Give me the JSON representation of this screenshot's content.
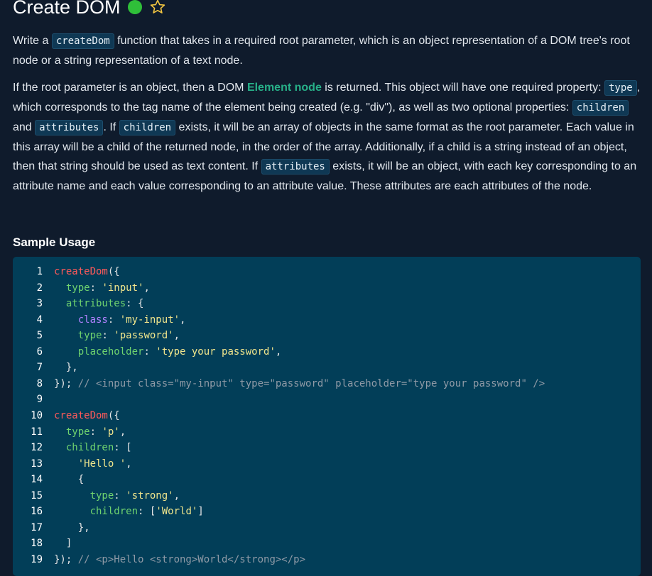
{
  "header": {
    "title": "Create DOM",
    "status_color": "#2fbf39",
    "star_icon": "star-outline-icon"
  },
  "description": {
    "p1": {
      "before": "Write a ",
      "code": "createDom",
      "after": " function that takes in a required root parameter, which is an object representation of a DOM tree's root node or a string representation of a text node."
    },
    "p2": {
      "t1": "If the root parameter is an object, then a DOM ",
      "link": "Element node",
      "t2": " is returned. This object will have one required property: ",
      "c1": "type",
      "t3": ", which corresponds to the tag name of the element being created (e.g. \"div\"), as well as two optional properties: ",
      "c2": "children",
      "t4": " and ",
      "c3": "attributes",
      "t5": ". If ",
      "c4": "children",
      "t6": " exists, it will be an array of objects in the same format as the root parameter. Each value in this array will be a child of the returned node, in the order of the array. Additionally, if a child is a string instead of an object, then that string should be used as text content. If ",
      "c5": "attributes",
      "t7": " exists, it will be an object, with each key corresponding to an attribute name and each value corresponding to an attribute value. These attributes are each attributes of the node."
    }
  },
  "sample": {
    "title": "Sample Usage",
    "lines": [
      {
        "n": "1",
        "tokens": [
          [
            "fn",
            "createDom"
          ],
          [
            "punc",
            "({"
          ]
        ]
      },
      {
        "n": "2",
        "tokens": [
          [
            "punc",
            "  "
          ],
          [
            "key",
            "type"
          ],
          [
            "punc",
            ": "
          ],
          [
            "str",
            "'input'"
          ],
          [
            "punc",
            ","
          ]
        ]
      },
      {
        "n": "3",
        "tokens": [
          [
            "punc",
            "  "
          ],
          [
            "key",
            "attributes"
          ],
          [
            "punc",
            ": {"
          ]
        ]
      },
      {
        "n": "4",
        "tokens": [
          [
            "punc",
            "    "
          ],
          [
            "attr",
            "class"
          ],
          [
            "punc",
            ": "
          ],
          [
            "str",
            "'my-input'"
          ],
          [
            "punc",
            ","
          ]
        ]
      },
      {
        "n": "5",
        "tokens": [
          [
            "punc",
            "    "
          ],
          [
            "key",
            "type"
          ],
          [
            "punc",
            ": "
          ],
          [
            "str",
            "'password'"
          ],
          [
            "punc",
            ","
          ]
        ]
      },
      {
        "n": "6",
        "tokens": [
          [
            "punc",
            "    "
          ],
          [
            "key",
            "placeholder"
          ],
          [
            "punc",
            ": "
          ],
          [
            "str",
            "'type your password'"
          ],
          [
            "punc",
            ","
          ]
        ]
      },
      {
        "n": "7",
        "tokens": [
          [
            "punc",
            "  },"
          ]
        ]
      },
      {
        "n": "8",
        "tokens": [
          [
            "punc",
            "}); "
          ],
          [
            "comment",
            "// <input class=\"my-input\" type=\"password\" placeholder=\"type your password\" />"
          ]
        ]
      },
      {
        "n": "9",
        "tokens": []
      },
      {
        "n": "10",
        "tokens": [
          [
            "fn",
            "createDom"
          ],
          [
            "punc",
            "({"
          ]
        ]
      },
      {
        "n": "11",
        "tokens": [
          [
            "punc",
            "  "
          ],
          [
            "key",
            "type"
          ],
          [
            "punc",
            ": "
          ],
          [
            "str",
            "'p'"
          ],
          [
            "punc",
            ","
          ]
        ]
      },
      {
        "n": "12",
        "tokens": [
          [
            "punc",
            "  "
          ],
          [
            "key",
            "children"
          ],
          [
            "punc",
            ": ["
          ]
        ]
      },
      {
        "n": "13",
        "tokens": [
          [
            "punc",
            "    "
          ],
          [
            "str",
            "'Hello '"
          ],
          [
            "punc",
            ","
          ]
        ]
      },
      {
        "n": "14",
        "tokens": [
          [
            "punc",
            "    {"
          ]
        ]
      },
      {
        "n": "15",
        "tokens": [
          [
            "punc",
            "      "
          ],
          [
            "key",
            "type"
          ],
          [
            "punc",
            ": "
          ],
          [
            "str",
            "'strong'"
          ],
          [
            "punc",
            ","
          ]
        ]
      },
      {
        "n": "16",
        "tokens": [
          [
            "punc",
            "      "
          ],
          [
            "key",
            "children"
          ],
          [
            "punc",
            ": ["
          ],
          [
            "str",
            "'World'"
          ],
          [
            "punc",
            "]"
          ]
        ]
      },
      {
        "n": "17",
        "tokens": [
          [
            "punc",
            "    },"
          ]
        ]
      },
      {
        "n": "18",
        "tokens": [
          [
            "punc",
            "  ]"
          ]
        ]
      },
      {
        "n": "19",
        "tokens": [
          [
            "punc",
            "}); "
          ],
          [
            "comment",
            "// <p>Hello <strong>World</strong></p>"
          ]
        ]
      }
    ]
  }
}
